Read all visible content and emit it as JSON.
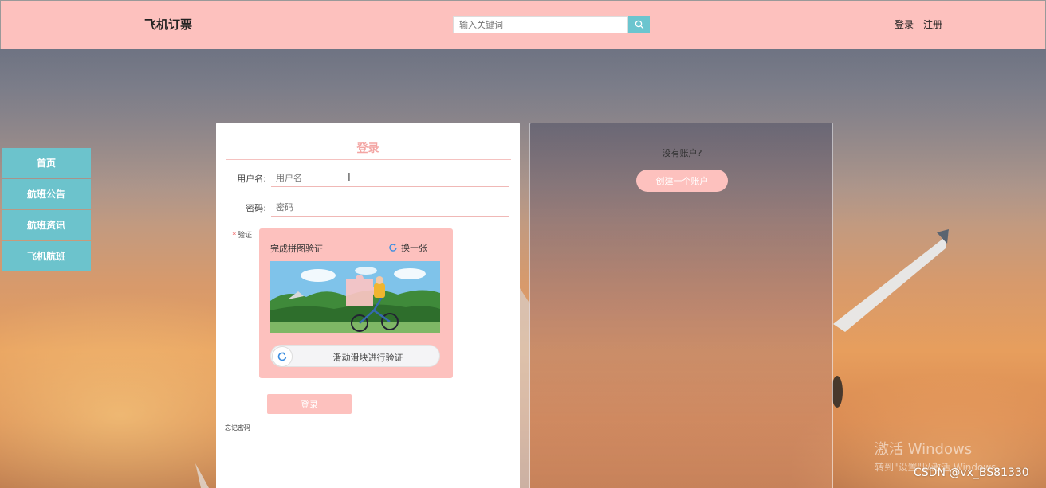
{
  "header": {
    "brand": "飞机订票",
    "search_placeholder": "输入关键词",
    "login": "登录",
    "register": "注册"
  },
  "side_nav": {
    "items": [
      "首页",
      "航班公告",
      "航班资讯",
      "飞机航班"
    ]
  },
  "login_form": {
    "title": "登录",
    "username_label": "用户名:",
    "username_placeholder": "用户名",
    "password_label": "密码:",
    "password_placeholder": "密码",
    "verify_label": "验证",
    "captcha": {
      "title": "完成拼图验证",
      "refresh": "换一张",
      "slider_text": "滑动滑块进行验证"
    },
    "submit": "登录",
    "forgot": "忘记密码"
  },
  "register_panel": {
    "prompt": "没有账户?",
    "create_button": "创建一个账户"
  },
  "watermark": {
    "line1": "激活 Windows",
    "line2": "转到\"设置\"以激活 Windows。",
    "csdn": "CSDN @vx_BS81330"
  },
  "colors": {
    "header_bg": "#fdc1be",
    "nav_bg": "#6cc3cc",
    "accent_pink": "#fdc1be",
    "title_pink": "#f3a5a3",
    "search_button": "#6bc5cf"
  }
}
